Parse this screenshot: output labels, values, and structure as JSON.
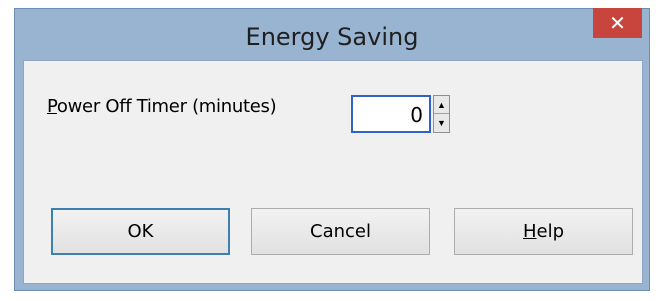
{
  "dialog": {
    "title": "Energy Saving",
    "close_label": "✕"
  },
  "power_off_timer": {
    "label_accel": "P",
    "label_rest": "ower Off Timer (minutes)",
    "value": "0"
  },
  "buttons": {
    "ok": "OK",
    "cancel": "Cancel",
    "help_accel": "H",
    "help_rest": "elp"
  },
  "colors": {
    "frame": "#99b4d1",
    "close": "#c7453c",
    "client": "#f0f0f0",
    "focus_border": "#2f63c6"
  }
}
